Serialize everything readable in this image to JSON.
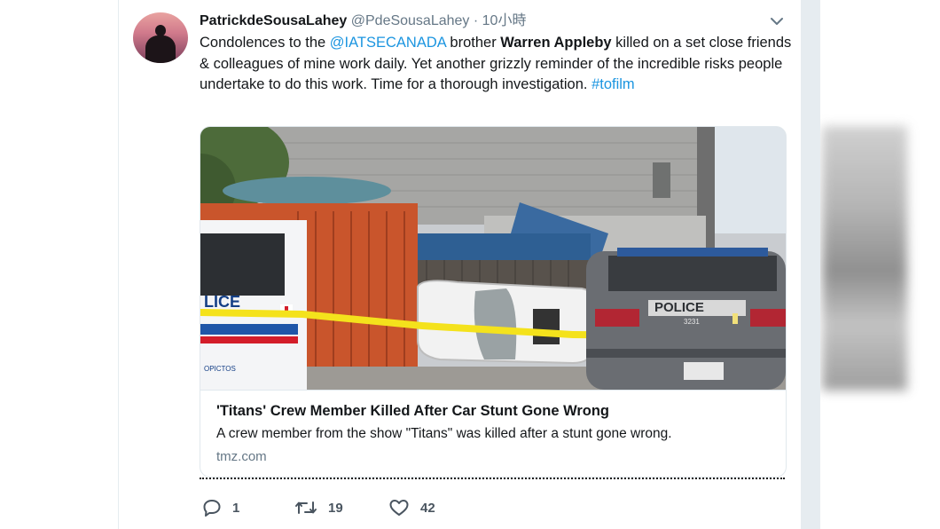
{
  "tweet": {
    "display_name": "PatrickdeSousaLahey",
    "handle": "@PdeSousaLahey",
    "separator": "·",
    "time": "10小時",
    "text": {
      "p1": "Condolences to the ",
      "mention": "@IATSECANADA",
      "p2": " brother ",
      "bold": "Warren Appleby",
      "p3": " killed on a set close friends & colleagues of mine work daily. Yet another grizzly reminder of the incredible risks people undertake to do this work. Time for a thorough investigation. ",
      "hashtag": "#tofilm"
    }
  },
  "card": {
    "title": "'Titans' Crew Member Killed After Car Stunt Gone Wrong",
    "description": "A crew member from the show \"Titans\" was killed after a stunt gone wrong.",
    "domain": "tmz.com",
    "image": {
      "police_text_left": "LICE",
      "police_text_right": "POLICE",
      "car_number": "3231",
      "car_side_text": "OPICTOS"
    }
  },
  "actions": {
    "reply_count": "1",
    "retweet_count": "19",
    "like_count": "42"
  },
  "colors": {
    "link": "#1b95e0",
    "secondary_text": "#657786",
    "border": "#e1e8ed",
    "gutter": "#e6ecf0"
  },
  "icons": [
    "chevron-down-icon",
    "reply-icon",
    "retweet-icon",
    "heart-icon"
  ]
}
